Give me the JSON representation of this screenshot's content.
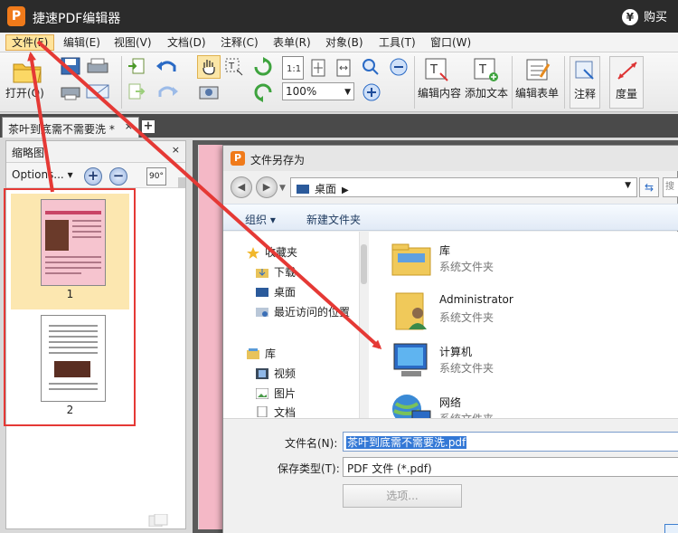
{
  "app": {
    "logo_letter": "P",
    "title": "捷速PDF编辑器",
    "buy_label": "购买",
    "buy_icon": "yen-icon"
  },
  "menu": {
    "items": [
      {
        "label": "文件(F)",
        "active": true
      },
      {
        "label": "编辑(E)"
      },
      {
        "label": "视图(V)"
      },
      {
        "label": "文档(D)"
      },
      {
        "label": "注释(C)"
      },
      {
        "label": "表单(R)"
      },
      {
        "label": "对象(B)"
      },
      {
        "label": "工具(T)"
      },
      {
        "label": "窗口(W)"
      }
    ]
  },
  "toolbar": {
    "open_label": "打开(O)",
    "zoom_value": "100%",
    "edit_content_label": "编辑内容",
    "add_text_label": "添加文本",
    "edit_form_label": "编辑表单",
    "annotate_label": "注释",
    "measure_label": "度量",
    "rotate_label": "90°"
  },
  "tabs": {
    "doc_tab_label": "茶叶到底需不需要洗 *",
    "close_glyph": "×",
    "add_glyph": "+"
  },
  "thumbs": {
    "panel_title": "缩略图",
    "close_glyph": "×",
    "options_label": "Options...",
    "zoom_in_glyph": "+",
    "zoom_out_glyph": "−",
    "pages": [
      {
        "number": "1"
      },
      {
        "number": "2"
      }
    ]
  },
  "dialog": {
    "logo_letter": "P",
    "title": "文件另存为",
    "address": "桌面",
    "organize_label": "组织 ▾",
    "new_folder_label": "新建文件夹",
    "nav_items": [
      {
        "label": "收藏夹",
        "icon": "star-icon"
      },
      {
        "label": "下载",
        "icon": "download-folder-icon"
      },
      {
        "label": "桌面",
        "icon": "desktop-icon"
      },
      {
        "label": "最近访问的位置",
        "icon": "recent-places-icon"
      },
      {
        "label": "库",
        "icon": "library-icon"
      },
      {
        "label": "视频",
        "icon": "video-icon"
      },
      {
        "label": "图片",
        "icon": "picture-icon"
      },
      {
        "label": "文档",
        "icon": "document-icon"
      }
    ],
    "files": [
      {
        "name": "库",
        "type": "系统文件夹",
        "icon": "library-folder-icon"
      },
      {
        "name": "Administrator",
        "type": "系统文件夹",
        "icon": "user-folder-icon"
      },
      {
        "name": "计算机",
        "type": "系统文件夹",
        "icon": "computer-icon"
      },
      {
        "name": "网络",
        "type": "系统文件夹",
        "icon": "network-icon"
      }
    ],
    "filename_label": "文件名(N):",
    "filename_value": "茶叶到底需不需要洗.pdf",
    "filetype_label": "保存类型(T):",
    "filetype_value": "PDF 文件 (*.pdf)",
    "options_button": "选项..."
  },
  "colors": {
    "annotation_red": "#e53935",
    "title_bg": "#2b2b2b",
    "accent_orange": "#f07a1a",
    "selection_blue": "#3378d6"
  }
}
